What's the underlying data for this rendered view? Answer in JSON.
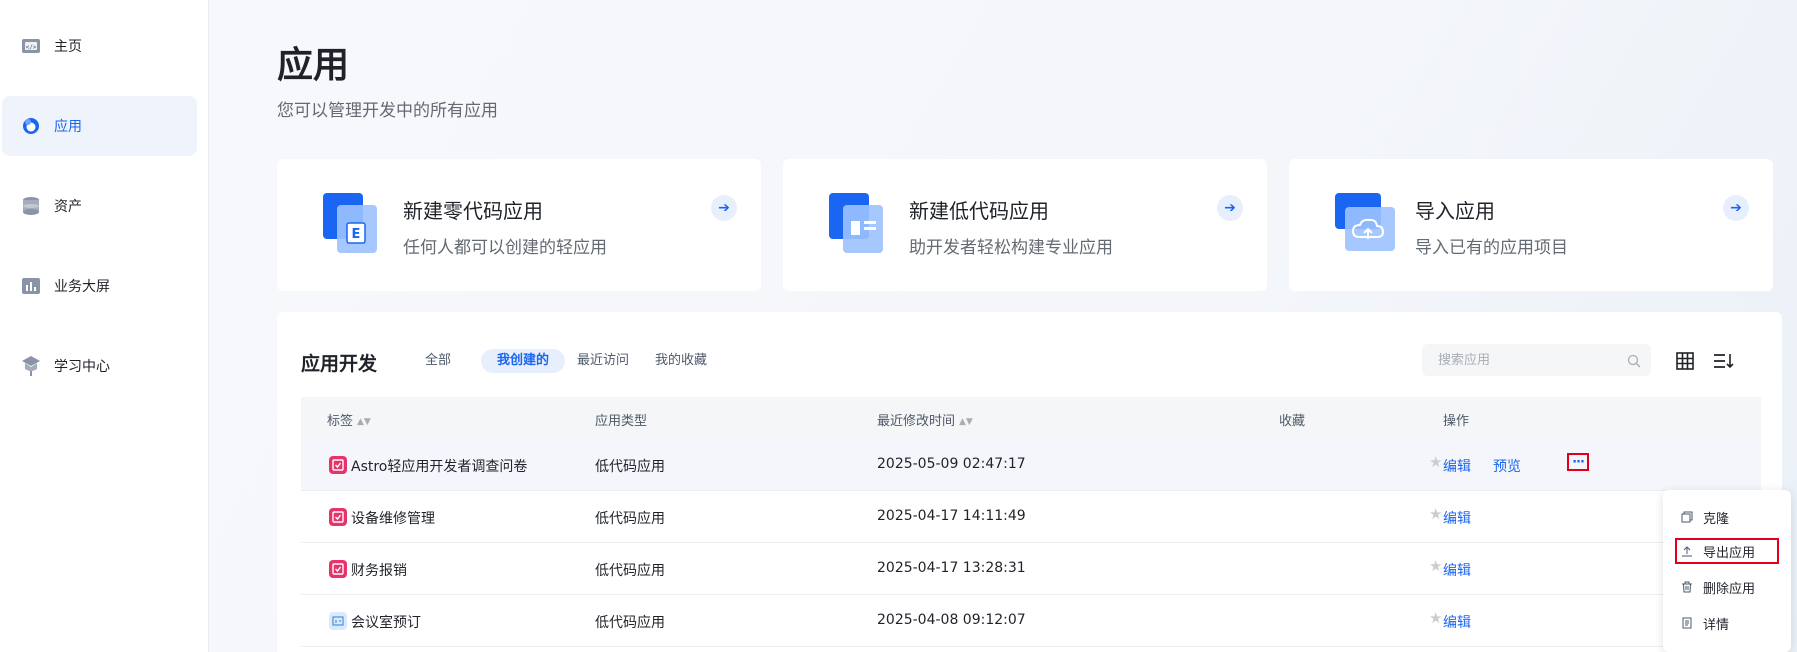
{
  "sidebar": {
    "items": [
      {
        "label": "主页",
        "icon": "code-window-icon",
        "active": false
      },
      {
        "label": "应用",
        "icon": "app-icon",
        "active": true
      },
      {
        "label": "资产",
        "icon": "database-icon",
        "active": false
      },
      {
        "label": "业务大屏",
        "icon": "dashboard-icon",
        "active": false
      },
      {
        "label": "学习中心",
        "icon": "learning-icon",
        "active": false
      }
    ]
  },
  "header": {
    "title": "应用",
    "subtitle": "您可以管理开发中的所有应用"
  },
  "cards": [
    {
      "title": "新建零代码应用",
      "desc": "任何人都可以创建的轻应用",
      "icon": "zero-code-icon"
    },
    {
      "title": "新建低代码应用",
      "desc": "助开发者轻松构建专业应用",
      "icon": "low-code-icon"
    },
    {
      "title": "导入应用",
      "desc": "导入已有的应用项目",
      "icon": "cloud-import-icon"
    }
  ],
  "panel": {
    "title": "应用开发",
    "tabs": [
      "全部",
      "我创建的",
      "最近访问",
      "我的收藏"
    ],
    "active_tab": "我创建的",
    "search_placeholder": "搜索应用"
  },
  "table": {
    "columns": [
      "标签",
      "应用类型",
      "最近修改时间",
      "收藏",
      "操作"
    ],
    "rows": [
      {
        "name": "Astro轻应用开发者调查问卷",
        "type": "低代码应用",
        "modified": "2025-05-09 02:47:17",
        "edit": "编辑",
        "preview": "预览",
        "more": "···"
      },
      {
        "name": "设备维修管理",
        "type": "低代码应用",
        "modified": "2025-04-17 14:11:49",
        "edit": "编辑"
      },
      {
        "name": "财务报销",
        "type": "低代码应用",
        "modified": "2025-04-17 13:28:31",
        "edit": "编辑"
      },
      {
        "name": "会议室预订",
        "type": "低代码应用",
        "modified": "2025-04-08 09:12:07",
        "edit": "编辑"
      }
    ]
  },
  "menu": {
    "items": [
      {
        "label": "克隆",
        "icon": "copy-icon"
      },
      {
        "label": "导出应用",
        "icon": "export-icon"
      },
      {
        "label": "删除应用",
        "icon": "trash-icon"
      },
      {
        "label": "详情",
        "icon": "doc-icon"
      }
    ]
  },
  "colors": {
    "accent": "#1a66f2",
    "highlight": "#e0001b",
    "app_icon_pink": "#e8336a"
  }
}
